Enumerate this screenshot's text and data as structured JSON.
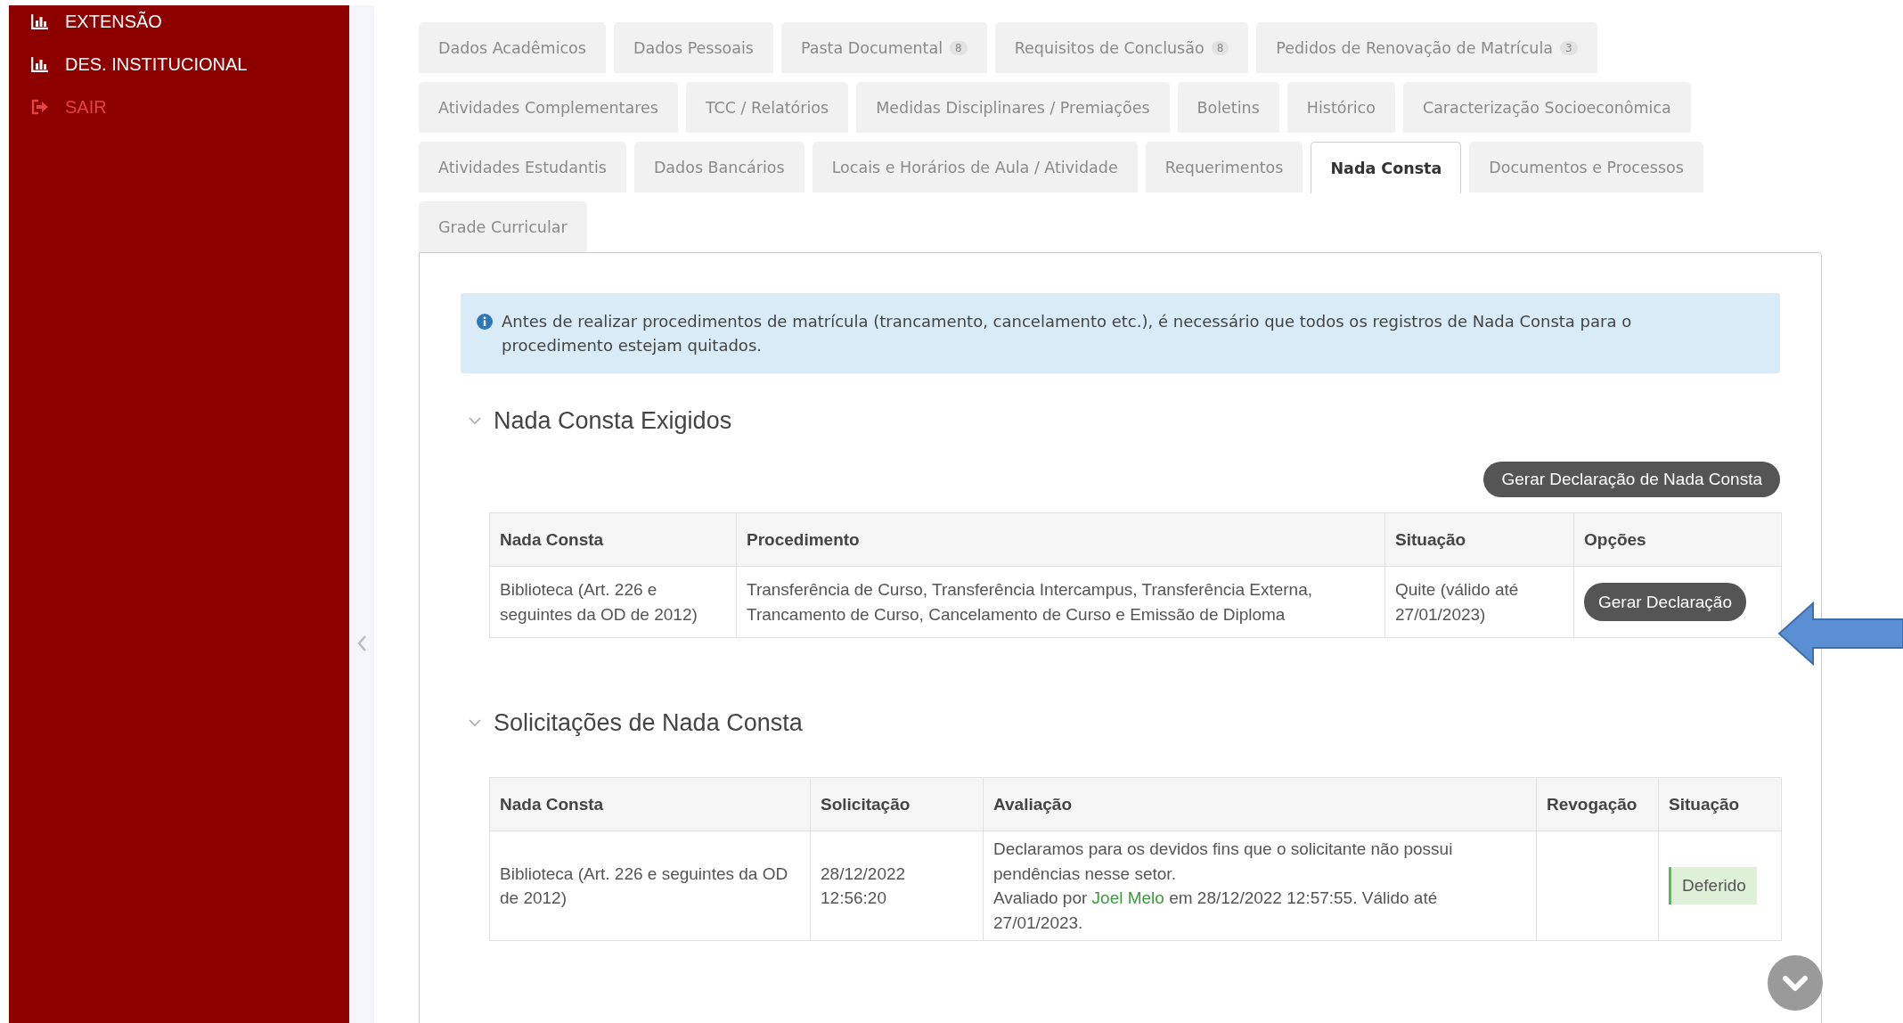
{
  "sidebar": {
    "items": [
      {
        "label": "EXTENSÃO",
        "kind": "chart"
      },
      {
        "label": "DES. INSTITUCIONAL",
        "kind": "chart"
      },
      {
        "label": "SAIR",
        "kind": "logout"
      }
    ]
  },
  "tabs": [
    {
      "label": "Dados Acadêmicos",
      "selected": false
    },
    {
      "label": "Dados Pessoais",
      "selected": false
    },
    {
      "label": "Pasta Documental",
      "badge": "8",
      "selected": false
    },
    {
      "label": "Requisitos de Conclusão",
      "badge": "8",
      "selected": false
    },
    {
      "label": "Pedidos de Renovação de Matrícula",
      "badge": "3",
      "selected": false
    },
    {
      "label": "Atividades Complementares",
      "selected": false
    },
    {
      "label": "TCC / Relatórios",
      "selected": false
    },
    {
      "label": "Medidas Disciplinares / Premiações",
      "selected": false
    },
    {
      "label": "Boletins",
      "selected": false
    },
    {
      "label": "Histórico",
      "selected": false
    },
    {
      "label": "Caracterização Socioeconômica",
      "selected": false
    },
    {
      "label": "Atividades Estudantis",
      "selected": false
    },
    {
      "label": "Dados Bancários",
      "selected": false
    },
    {
      "label": "Locais e Horários de Aula / Atividade",
      "selected": false
    },
    {
      "label": "Requerimentos",
      "selected": false
    },
    {
      "label": "Nada Consta",
      "selected": true
    },
    {
      "label": "Documentos e Processos",
      "selected": false
    },
    {
      "label": "Grade Curricular",
      "selected": false
    }
  ],
  "alert": {
    "text": "Antes de realizar procedimentos de matrícula (trancamento, cancelamento etc.), é necessário que todos os registros de Nada Consta para o procedimento estejam quitados."
  },
  "sections": [
    {
      "title": "Nada Consta Exigidos",
      "action_button": "Gerar Declaração de Nada Consta",
      "table": {
        "columns": [
          "Nada Consta",
          "Procedimento",
          "Situação",
          "Opções"
        ],
        "rows": [
          {
            "cells": [
              {
                "kind": "text",
                "text": "Biblioteca (Art. 226 e seguintes da OD de 2012)"
              },
              {
                "kind": "text",
                "text": "Transferência de Curso, Transferência Intercampus, Transferência Externa, Trancamento de Curso, Cancelamento de Curso e Emissão de Diploma"
              },
              {
                "kind": "text",
                "text": "Quite (válido até 27/01/2023)"
              },
              {
                "kind": "button",
                "label": "Gerar Declaração"
              }
            ]
          }
        ]
      }
    },
    {
      "title": "Solicitações de Nada Consta",
      "table": {
        "columns": [
          "Nada Consta",
          "Solicitação",
          "Avaliação",
          "Revogação",
          "Situação"
        ],
        "rows": [
          {
            "cells": [
              {
                "kind": "text",
                "text": "Biblioteca (Art. 226 e seguintes da OD de 2012)"
              },
              {
                "kind": "text",
                "text": "28/12/2022 12:56:20"
              },
              {
                "kind": "evaluation",
                "declaration": "Declaramos para os devidos fins que o solicitante não possui pendências nesse setor.",
                "prefix": "Avaliado por",
                "evaluator": "Joel Melo",
                "suffix": "em 28/12/2022 12:57:55. Válido até 27/01/2023."
              },
              {
                "kind": "empty"
              },
              {
                "kind": "status",
                "label": "Deferido"
              }
            ]
          }
        ]
      }
    }
  ]
}
